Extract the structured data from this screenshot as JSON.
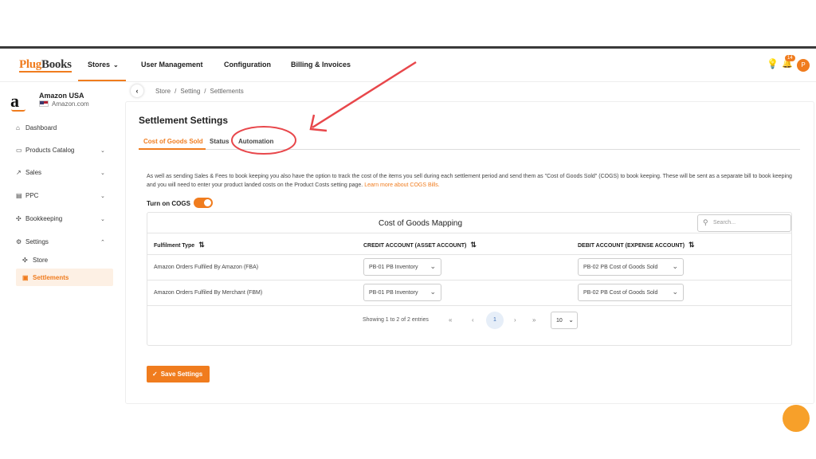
{
  "brand": {
    "logo_plug": "Plug",
    "logo_books": "Books",
    "accent": "#f07c1e"
  },
  "nav": {
    "stores": "Stores",
    "user_management": "User Management",
    "configuration": "Configuration",
    "billing": "Billing & Invoices",
    "notification_count": "14",
    "avatar_letter": "P"
  },
  "sidebar": {
    "store_logo": "a",
    "store_name": "Amazon USA",
    "store_url": "Amazon.com",
    "items": [
      {
        "label": "Dashboard",
        "icon": "home-icon"
      },
      {
        "label": "Products Catalog",
        "icon": "box-icon"
      },
      {
        "label": "Sales",
        "icon": "chart-icon"
      },
      {
        "label": "PPC",
        "icon": "ppc-icon"
      },
      {
        "label": "Bookkeeping",
        "icon": "bookkeeping-icon"
      },
      {
        "label": "Settings",
        "icon": "gear-icon"
      }
    ],
    "sub_items": [
      {
        "label": "Store",
        "icon": "store-icon"
      },
      {
        "label": "Settlements",
        "icon": "settlements-icon"
      }
    ]
  },
  "breadcrumb": {
    "items": [
      "Store",
      "Setting",
      "Settlements"
    ]
  },
  "page": {
    "title": "Settlement Settings",
    "tabs": [
      "Cost of Goods Sold",
      "Status",
      "Automation"
    ],
    "description": "As well as sending Sales & Fees to book keeping you also have the option to track the cost of the items you sell during each settlement period and send them as \"Cost of Goods Sold\" (COGS) to book keeping. These will be sent as a separate bill to book keeping and you will need to enter your product landed costs on the Product Costs setting page.",
    "learn_more": "Learn more about COGS Bills.",
    "toggle_label": "Turn on COGS",
    "toggle_on": true
  },
  "table": {
    "title": "Cost of Goods Mapping",
    "search_placeholder": "Search...",
    "columns": [
      "Fulfilment Type",
      "CREDIT ACCOUNT (ASSET ACCOUNT)",
      "DEBIT ACCOUNT (EXPENSE ACCOUNT)"
    ],
    "rows": [
      {
        "type": "Amazon Orders Fulfiled By Amazon (FBA)",
        "credit": "PB-01 PB Inventory",
        "debit": "PB-02 PB Cost of Goods Sold"
      },
      {
        "type": "Amazon Orders Fulfiled By Merchant (FBM)",
        "credit": "PB-01 PB Inventory",
        "debit": "PB-02 PB Cost of Goods Sold"
      }
    ],
    "pager_info": "Showing 1 to 2 of 2 entries",
    "current_page": "1",
    "page_size": "10"
  },
  "actions": {
    "save": "Save Settings"
  }
}
